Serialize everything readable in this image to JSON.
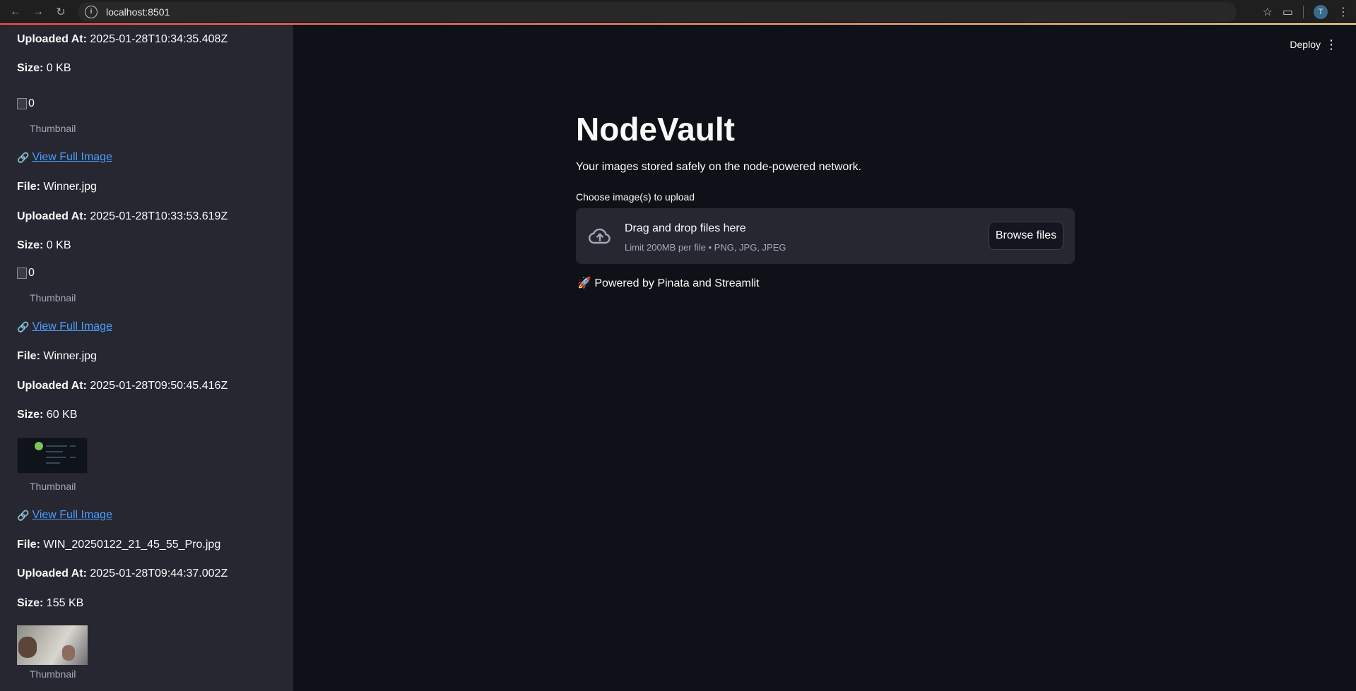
{
  "browser": {
    "url": "localhost:8501",
    "avatar_letter": "T"
  },
  "sidebar": {
    "entries": [
      {
        "uploaded_label": "Uploaded At:",
        "uploaded": "2025-01-28T10:34:35.408Z",
        "size_label": "Size:",
        "size": "0 KB",
        "thumb_alt": "0",
        "caption": "Thumbnail",
        "link": "View Full Image"
      },
      {
        "file_label": "File:",
        "file": "Winner.jpg",
        "uploaded_label": "Uploaded At:",
        "uploaded": "2025-01-28T10:33:53.619Z",
        "size_label": "Size:",
        "size": "0 KB",
        "thumb_alt": "0",
        "caption": "Thumbnail",
        "link": "View Full Image"
      },
      {
        "file_label": "File:",
        "file": "Winner.jpg",
        "uploaded_label": "Uploaded At:",
        "uploaded": "2025-01-28T09:50:45.416Z",
        "size_label": "Size:",
        "size": "60 KB",
        "caption": "Thumbnail",
        "link": "View Full Image"
      },
      {
        "file_label": "File:",
        "file": "WIN_20250122_21_45_55_Pro.jpg",
        "uploaded_label": "Uploaded At:",
        "uploaded": "2025-01-28T09:44:37.002Z",
        "size_label": "Size:",
        "size": "155 KB",
        "caption": "Thumbnail"
      }
    ]
  },
  "header": {
    "deploy": "Deploy"
  },
  "main": {
    "title": "NodeVault",
    "subtitle": "Your images stored safely on the node-powered network.",
    "upload_label": "Choose image(s) to upload",
    "dropzone_title": "Drag and drop files here",
    "dropzone_hint": "Limit 200MB per file • PNG, JPG, JPEG",
    "browse_button": "Browse files",
    "powered": "Powered by Pinata and Streamlit"
  }
}
